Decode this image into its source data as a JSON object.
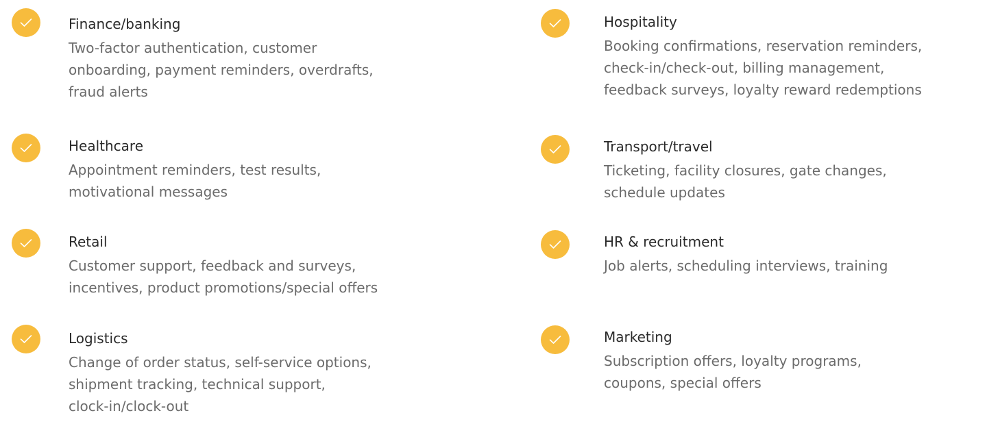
{
  "accent_color": "#f7bc3d",
  "title_color": "#2a2a2a",
  "description_color": "#6b6b6b",
  "items": [
    {
      "title": "Finance/banking",
      "lines": [
        "Two-factor authentication, customer",
        "onboarding, payment reminders, overdrafts,",
        "fraud alerts"
      ],
      "icon": "check-icon"
    },
    {
      "title": "Healthcare",
      "lines": [
        "Appointment reminders, test results,",
        "motivational messages"
      ],
      "icon": "check-icon"
    },
    {
      "title": "Retail",
      "lines": [
        "Customer support, feedback and surveys,",
        "incentives, product promotions/special offers"
      ],
      "icon": "check-icon"
    },
    {
      "title": "Logistics",
      "lines": [
        "Change of order status, self-service options,",
        "shipment tracking, technical support,",
        "clock-in/clock-out"
      ],
      "icon": "check-icon"
    },
    {
      "title": "Hospitality",
      "lines": [
        "Booking confirmations, reservation reminders,",
        "check-in/check-out, billing management,",
        "feedback surveys, loyalty reward redemptions"
      ],
      "icon": "check-icon"
    },
    {
      "title": "Transport/travel",
      "lines": [
        "Ticketing, facility closures, gate changes,",
        "schedule updates"
      ],
      "icon": "check-icon"
    },
    {
      "title": "HR & recruitment",
      "lines": [
        "Job alerts, scheduling interviews, training"
      ],
      "icon": "check-icon"
    },
    {
      "title": "Marketing",
      "lines": [
        "Subscription offers, loyalty programs,",
        "coupons, special offers"
      ],
      "icon": "check-icon"
    }
  ]
}
